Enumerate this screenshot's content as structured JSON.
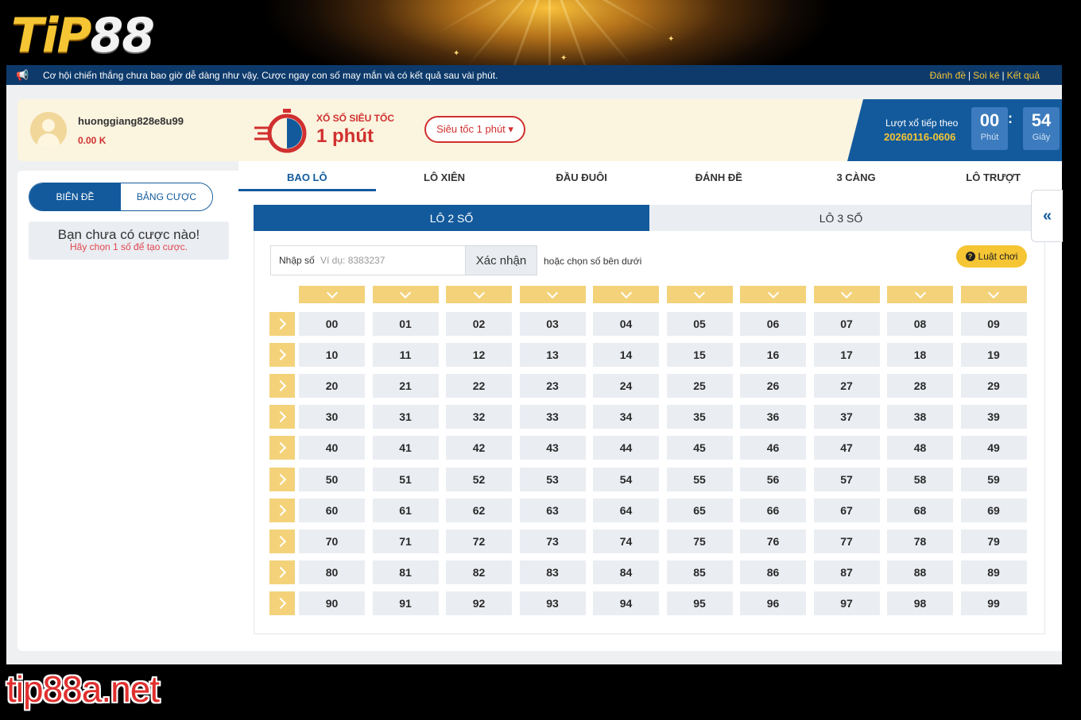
{
  "brand": {
    "logo_part1": "TiP",
    "logo_part2": "88",
    "site": "tip88a.net"
  },
  "ticker": {
    "icon": "megaphone-icon",
    "message": "Cơ hội chiến thắng chưa bao giờ dễ dàng như vậy. Cược ngay con số may mắn và có kết quả sau vài phút.",
    "links": [
      "Đánh đề",
      "Soi kê",
      "Kết quả"
    ]
  },
  "user": {
    "name": "huonggiang828e8u99",
    "balance": "0.00 K"
  },
  "bet_panel": {
    "toggle": [
      "BIÊN ĐỀ",
      "BẢNG CƯỢC"
    ],
    "empty_title": "Bạn chưa có cược nào!",
    "empty_sub": "Hãy chọn 1 số để tạo cược."
  },
  "game": {
    "subtitle": "XỔ SỐ SIÊU TỐC",
    "title": "1 phút",
    "select": "Siêu tốc 1 phút ▾",
    "next_label": "Lượt xổ tiếp theo",
    "draw_code": "20260116-0606",
    "minutes": "00",
    "minutes_unit": "Phút",
    "seconds": "54",
    "seconds_unit": "Giây"
  },
  "tabs": [
    "BAO LÔ",
    "LÔ XIÊN",
    "ĐẦU ĐUÔI",
    "ĐÁNH ĐỀ",
    "3 CÀNG",
    "LÔ TRƯỢT"
  ],
  "subtabs": [
    "LÔ 2 SỐ",
    "LÔ 3 SỐ"
  ],
  "input": {
    "label": "Nhập số",
    "placeholder": "Ví dụ: 8383237",
    "confirm": "Xác nhận",
    "or_text": "hoặc chọn số bên dưới"
  },
  "rules": "Luật chơi",
  "side_toggle": "«",
  "colors": {
    "primary": "#135a9c",
    "accent": "#f5c534",
    "danger": "#d0302f"
  }
}
